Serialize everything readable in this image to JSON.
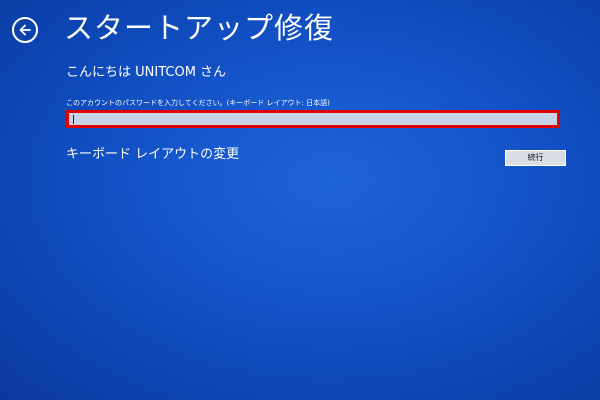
{
  "header": {
    "back_icon": "back-arrow-icon",
    "title": "スタートアップ修復"
  },
  "login": {
    "greeting": "こんにちは UNITCOM さん",
    "password_label": "このアカウントのパスワードを入力してください。(キーボード レイアウト: 日本語)",
    "password_value": ""
  },
  "actions": {
    "keyboard_layout_link": "キーボード レイアウトの変更",
    "continue_label": "続行"
  },
  "colors": {
    "background": "#1556cc",
    "highlight_border": "#e00000",
    "text": "#ffffff"
  }
}
